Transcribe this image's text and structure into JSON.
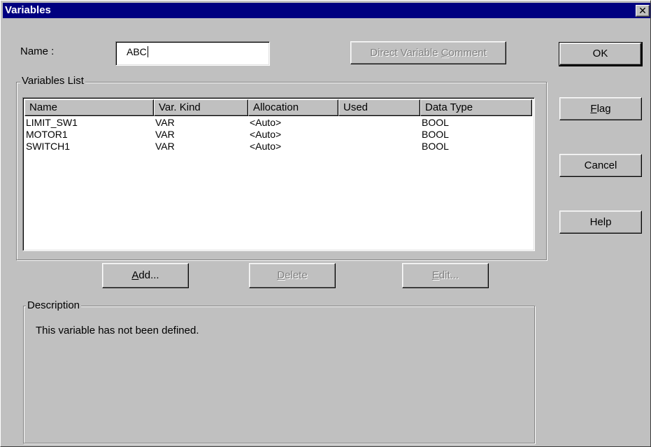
{
  "window": {
    "title": "Variables",
    "close_glyph": "✕"
  },
  "name_field": {
    "label": "Name :",
    "value": "ABC"
  },
  "buttons": {
    "direct_comment": {
      "pre": "Direct Variable ",
      "mn": "C",
      "post": "omment"
    },
    "ok": "OK",
    "flag": {
      "mn": "F",
      "post": "lag"
    },
    "cancel": "Cancel",
    "help": "Help",
    "add": {
      "mn": "A",
      "post": "dd..."
    },
    "delete": {
      "mn": "D",
      "post": "elete"
    },
    "edit": {
      "mn": "E",
      "post": "dit..."
    }
  },
  "variables_list": {
    "legend": "Variables List",
    "columns": [
      "Name",
      "Var. Kind",
      "Allocation",
      "Used",
      "Data Type"
    ],
    "rows": [
      [
        "LIMIT_SW1",
        "VAR",
        "<Auto>",
        "",
        "BOOL"
      ],
      [
        "MOTOR1",
        "VAR",
        "<Auto>",
        "",
        "BOOL"
      ],
      [
        "SWITCH1",
        "VAR",
        "<Auto>",
        "",
        "BOOL"
      ]
    ]
  },
  "description": {
    "legend": "Description",
    "text": "This variable has not been defined."
  }
}
